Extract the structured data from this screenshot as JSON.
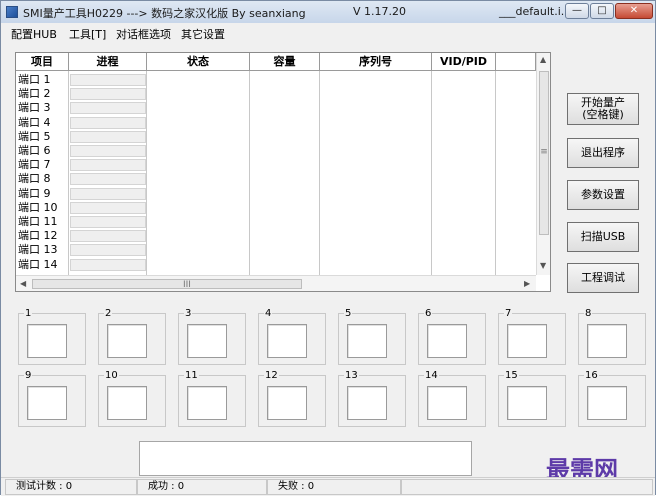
{
  "window": {
    "title": "SMI量产工具H0229 ---> 数码之家汉化版 By seanxiang",
    "version": "V 1.17.20",
    "file": "___default.i..."
  },
  "menu": [
    "配置HUB",
    "工具[T]",
    "对话框选项",
    "其它设置"
  ],
  "table": {
    "headers": [
      "项目",
      "进程",
      "状态",
      "容量",
      "序列号",
      "VID/PID"
    ],
    "ports": [
      "端口 1",
      "端口 2",
      "端口 3",
      "端口 4",
      "端口 5",
      "端口 6",
      "端口 7",
      "端口 8",
      "端口 9",
      "端口 10",
      "端口 11",
      "端口 12",
      "端口 13",
      "端口 14"
    ],
    "scroll_grip": "III",
    "vscroll_grip": "≡"
  },
  "buttons": {
    "start_line1": "开始量产",
    "start_line2": "(空格键)",
    "exit": "退出程序",
    "settings": "参数设置",
    "scan": "扫描USB",
    "debug": "工程调试"
  },
  "slots": [
    "1",
    "2",
    "3",
    "4",
    "5",
    "6",
    "7",
    "8",
    "9",
    "10",
    "11",
    "12",
    "13",
    "14",
    "15",
    "16"
  ],
  "status": {
    "test_count": "测试计数 : 0",
    "success": "成功 : 0",
    "fail": "失败 : 0"
  },
  "watermark": "最需网"
}
